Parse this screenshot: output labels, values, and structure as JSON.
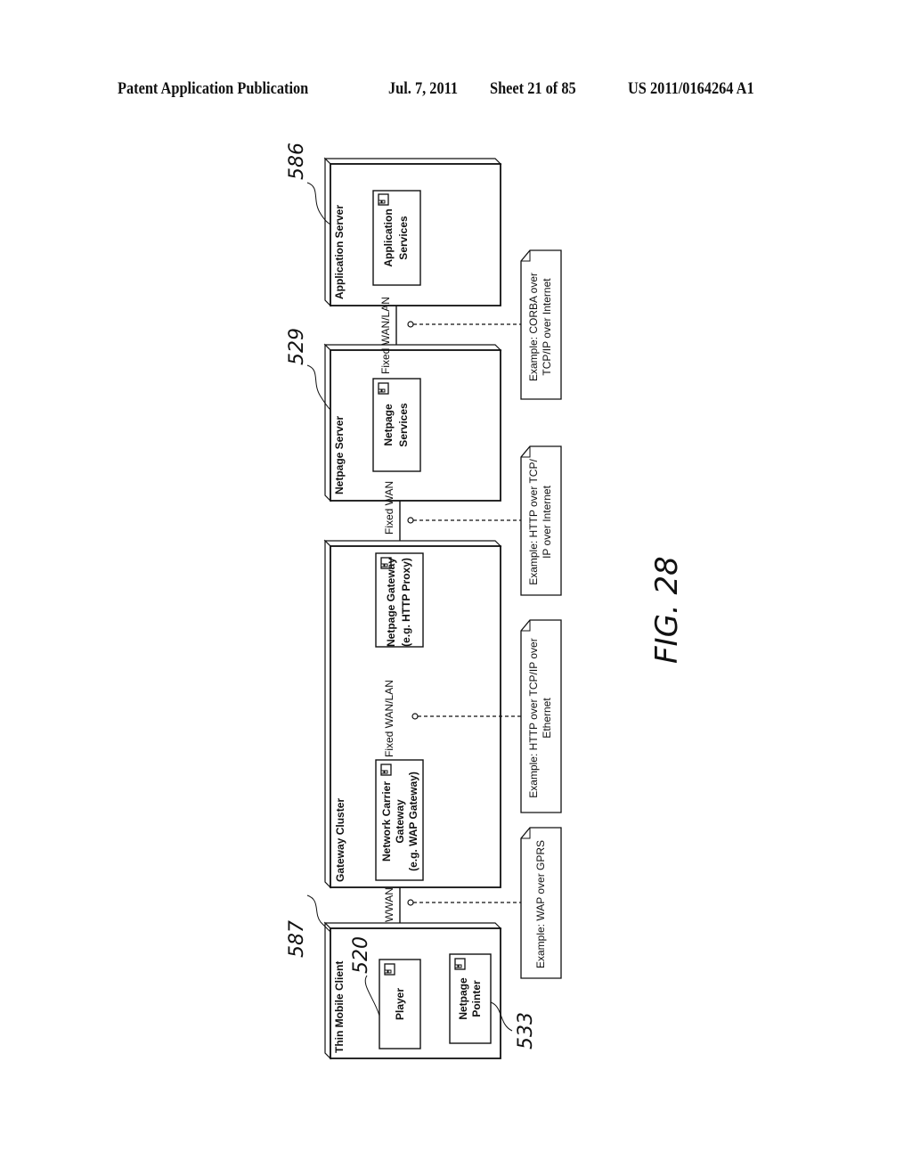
{
  "header": {
    "publication": "Patent Application Publication",
    "date": "Jul. 7, 2011",
    "sheet": "Sheet 21 of 85",
    "number": "US 2011/0164264 A1"
  },
  "figure": {
    "label": "FIG. 28",
    "nodes": [
      {
        "id": "application-server",
        "title": "Application Server",
        "ref": "586",
        "components": [
          {
            "lines": [
              "Application",
              "Services"
            ]
          }
        ]
      },
      {
        "id": "netpage-server",
        "title": "Netpage Server",
        "ref": "529",
        "components": [
          {
            "lines": [
              "Netpage",
              "Services"
            ]
          }
        ]
      },
      {
        "id": "gateway-cluster",
        "title": "Gateway Cluster",
        "ref": "",
        "components": [
          {
            "lines": [
              "Netpage Gateway",
              "(e.g. HTTP Proxy)"
            ]
          },
          {
            "lines": [
              "Network Carrier",
              "Gateway",
              "(e.g. WAP Gateway)"
            ]
          }
        ]
      },
      {
        "id": "thin-mobile-client",
        "title": "Thin Mobile Client",
        "ref": "587",
        "components": [
          {
            "lines": [
              "Player"
            ],
            "ref": "520"
          },
          {
            "lines": [
              "Netpage",
              "Pointer"
            ],
            "ref": "533"
          }
        ]
      }
    ],
    "links": [
      {
        "label": "Fixed WAN/LAN",
        "note": [
          "Example: CORBA over",
          "TCP/IP over Internet"
        ]
      },
      {
        "label": "Fixed WAN",
        "note": [
          "Example: HTTP over TCP/",
          "IP over Internet"
        ]
      },
      {
        "label": "Fixed WAN/LAN",
        "note": [
          "Example: HTTP over TCP/IP over",
          "Ethernet"
        ]
      },
      {
        "label": "WWAN",
        "note": [
          "Example: WAP over GPRS"
        ]
      }
    ]
  }
}
